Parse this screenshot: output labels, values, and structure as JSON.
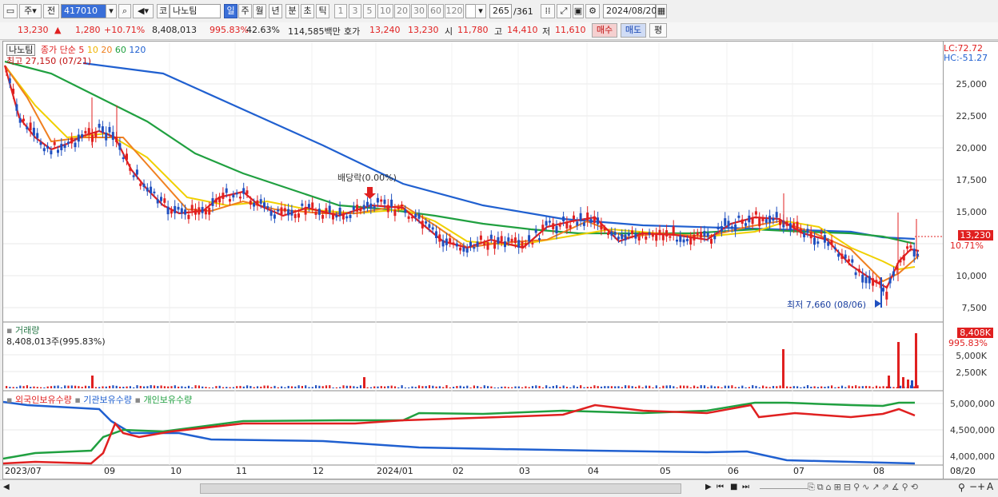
{
  "toolbar": {
    "btn_ju": "주",
    "btn_jeon": "전",
    "code": "417010",
    "market_tag": "코",
    "stock_name": "나노팀",
    "periods": [
      "일",
      "주",
      "월",
      "년",
      "분",
      "초",
      "틱"
    ],
    "selected_period": "일",
    "intervals": [
      "1",
      "3",
      "5",
      "10",
      "20",
      "30",
      "60",
      "120"
    ],
    "count": "265",
    "total": "/361",
    "date": "2024/08/20"
  },
  "quote": {
    "price": "13,230",
    "change": "1,280",
    "change_pct": "+10.71%",
    "volume": "8,408,013",
    "vol_ratio": "995.83%",
    "rate": "42.63%",
    "amount": "114,585백만",
    "ask_label": "호가",
    "ask1": "13,240",
    "ask2": "13,230",
    "open_label": "시",
    "open": "11,780",
    "high_label": "고",
    "high": "14,410",
    "low_label": "저",
    "low": "11,610",
    "buy": "매수",
    "sell": "매도",
    "eval": "평"
  },
  "price_panel": {
    "title": "나노팀",
    "legend_label": "종가 단순",
    "legend_ma": [
      {
        "name": "5",
        "color": "#e02020"
      },
      {
        "name": "10",
        "color": "#f0b400"
      },
      {
        "name": "20",
        "color": "#f08020"
      },
      {
        "name": "60",
        "color": "#20a040"
      },
      {
        "name": "120",
        "color": "#2060d0"
      }
    ],
    "high_note": "최고 27,150 (07/21)",
    "low_note": "최저 7,660 (08/06)",
    "dividend_note": "배당락(0.00%)",
    "lc": "LC:72.72",
    "hc": "HC:-51.27",
    "price_badge": "13,230",
    "pct_badge": "10.71%",
    "yticks": [
      "25,000",
      "22,500",
      "20,000",
      "17,500",
      "15,000",
      "12,500",
      "10,000",
      "7,500"
    ]
  },
  "volume_panel": {
    "title": "거래량",
    "value": "8,408,013주(995.83%)",
    "badge": "8,408K",
    "pct": "995.83%",
    "yticks": [
      "5,000K",
      "2,500K"
    ]
  },
  "holding_panel": {
    "legend": [
      {
        "name": "외국인보유수량",
        "color": "#e02020"
      },
      {
        "name": "기관보유수량",
        "color": "#2060d0"
      },
      {
        "name": "개인보유수량",
        "color": "#20a040"
      }
    ],
    "yticks": [
      "5,000,000",
      "4,500,000",
      "4,000,000"
    ]
  },
  "x_axis": {
    "labels": [
      "2023/07",
      "09",
      "10",
      "11",
      "12",
      "2024/01",
      "02",
      "03",
      "04",
      "05",
      "06",
      "07",
      "08"
    ],
    "right_label": "08/20"
  },
  "colors": {
    "up": "#e02020",
    "down": "#2050c0",
    "ma5": "#e02020",
    "ma10": "#f0d000",
    "ma20": "#f08020",
    "ma60": "#20a040",
    "ma120": "#2060d0"
  }
}
